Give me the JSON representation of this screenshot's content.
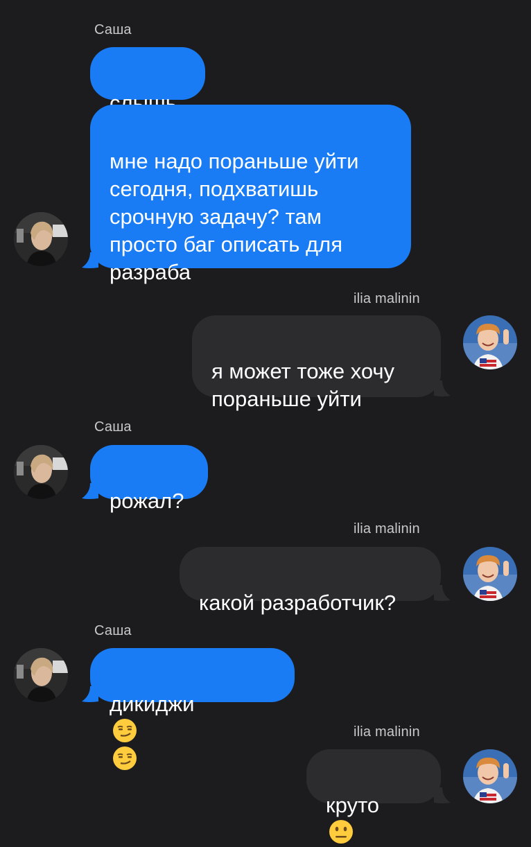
{
  "participants": {
    "sasha": {
      "name": "Саша",
      "avatar_icon": "woman-portrait-avatar"
    },
    "ilia": {
      "name": "ilia malinin",
      "avatar_icon": "smiling-man-avatar"
    }
  },
  "messages": [
    {
      "sender": "sasha",
      "text": "слышь"
    },
    {
      "sender": "sasha",
      "text": "мне надо пораньше уйти\nсегодня, подхватишь\nсрочную задачу? там\nпросто баг описать для\nразраба"
    },
    {
      "sender": "ilia",
      "text": "я может тоже хочу\nпораньше уйти"
    },
    {
      "sender": "sasha",
      "text": "рожал?"
    },
    {
      "sender": "ilia",
      "text": "какой разработчик?"
    },
    {
      "sender": "sasha",
      "text": "дикиджи",
      "emojis": [
        "smirking-face",
        "smirking-face"
      ]
    },
    {
      "sender": "ilia",
      "text": "круто",
      "emojis": [
        "neutral-face"
      ]
    }
  ],
  "colors": {
    "background": "#1c1c1e",
    "incoming_bubble": "#1a7cf5",
    "outgoing_bubble": "#2c2c2e",
    "sender_name": "#c9c9cc"
  }
}
